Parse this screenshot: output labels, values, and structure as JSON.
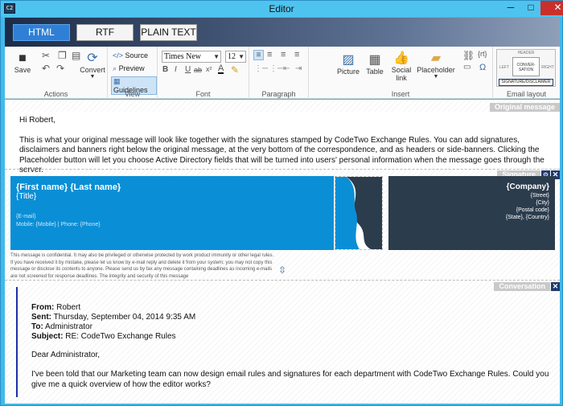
{
  "window": {
    "title": "Editor",
    "min_glyph": "─",
    "max_glyph": "□",
    "close_glyph": "✕",
    "app_icon_text": "C2"
  },
  "format_tabs": [
    "HTML",
    "RTF",
    "PLAIN TEXT"
  ],
  "ribbon": {
    "actions": {
      "save": "Save",
      "convert": "Convert",
      "label": "Actions"
    },
    "view": {
      "source": "Source",
      "preview": "Preview",
      "guidelines": "Guidelines",
      "label": "View"
    },
    "font": {
      "family": "Times New Roman",
      "size": "12",
      "label": "Font"
    },
    "paragraph": {
      "label": "Paragraph"
    },
    "insert": {
      "picture": "Picture",
      "table": "Table",
      "social": "Social link",
      "placeholder": "Placeholder",
      "label": "Insert"
    },
    "layout": {
      "header": "HEADER",
      "left": "LEFT",
      "conversation": "CONVER-SATION",
      "right": "RIGHT",
      "footer": "SIGNATURE/DISCLAIMER",
      "label": "Email layout"
    }
  },
  "original": {
    "tag": "Original message",
    "greeting": "Hi Robert,",
    "body": "This is what your original message will look like together with the signatures stamped by CodeTwo Exchange Rules. You can add signatures, disclaimers and banners right below the original message, at the very bottom of the correspondence, and as headers or side-banners. Clicking the Placeholder button will let you choose Active Directory fields that will be turned into users' personal information when the message goes through the server."
  },
  "signature": {
    "tag": "Signature",
    "name": "{First name} {Last name}",
    "title": "{Title}",
    "email": "{E-mail}",
    "phones": "Mobile: {Mobile} | Phone: {Phone}",
    "company": "{Company}",
    "street": "{Street}",
    "city": "{City}",
    "postal": "{Postal code}",
    "state": "{State}, {Country}",
    "disclaimer": "This message is confidential. It may also be privileged or otherwise protected by work product immunity or other legal rules. If you have received it by mistake, please let us know by e-mail reply and delete it from your system; you may not copy this message or disclose its contents to anyone. Please send us by fax any message containing deadlines as incoming e-mails are not screened for response deadlines. The integrity and security of this message"
  },
  "conversation": {
    "tag": "Conversation",
    "from_label": "From:",
    "from": "Robert",
    "sent_label": "Sent:",
    "sent": "Thursday, September 04, 2014 9:35 AM",
    "to_label": "To:",
    "to": "Administrator",
    "subject_label": "Subject:",
    "subject": "RE: CodeTwo Exchange Rules",
    "greeting": "Dear Administrator,",
    "body": "I've been told that our Marketing team can now design email rules and signatures for each department with CodeTwo Exchange Rules. Could you give me a quick overview of how the editor works?"
  },
  "colors": {
    "accent": "#3fbbe8",
    "signature_blue": "#0a8fd6",
    "signature_dark": "#2b3c4d",
    "close_red": "#c9302c"
  }
}
